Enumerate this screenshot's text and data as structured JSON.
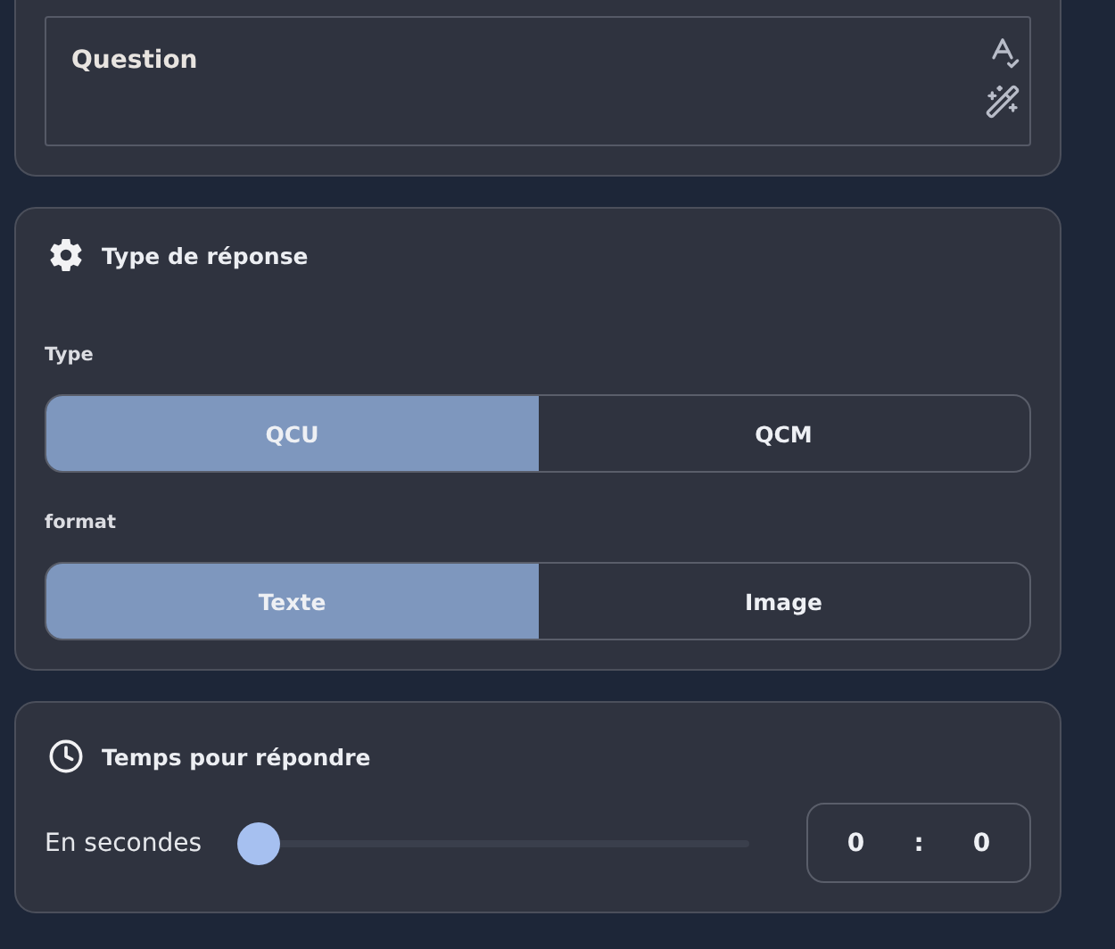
{
  "question": {
    "placeholder": "Question"
  },
  "response_type": {
    "title": "Type de réponse",
    "groups": [
      {
        "label": "Type",
        "options": [
          {
            "label": "QCU",
            "selected": true
          },
          {
            "label": "QCM",
            "selected": false
          }
        ]
      },
      {
        "label": "format",
        "options": [
          {
            "label": "Texte",
            "selected": true
          },
          {
            "label": "Image",
            "selected": false
          }
        ]
      }
    ]
  },
  "time": {
    "title": "Temps pour répondre",
    "slider_label": "En secondes",
    "level": 0,
    "minutes": "0",
    "separator": ":",
    "seconds": "0"
  }
}
